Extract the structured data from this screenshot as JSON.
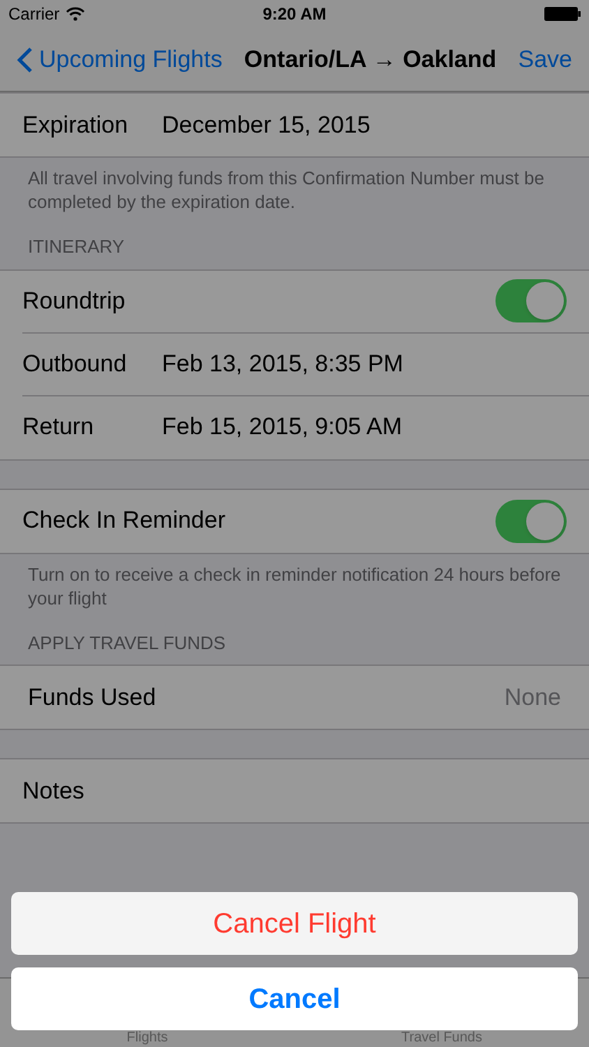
{
  "status_bar": {
    "carrier": "Carrier",
    "time": "9:20 AM"
  },
  "nav_bar": {
    "back": "Upcoming Flights",
    "title": "Ontario/LA → Oakland",
    "action": "Save"
  },
  "sections": [
    {
      "rows": [
        {
          "kind": "value",
          "label": "Expiration",
          "value": "December 15, 2015"
        }
      ],
      "footer": "All travel involving funds from this Confirmation Number must be completed by the expiration date."
    },
    {
      "header": "ITINERARY",
      "rows": [
        {
          "kind": "switch",
          "label": "Roundtrip",
          "on": true
        },
        {
          "kind": "value",
          "label": "Outbound",
          "value": "Feb 13, 2015, 8:35 PM"
        },
        {
          "kind": "value",
          "label": "Return",
          "value": "Feb 15, 2015, 9:05 AM"
        }
      ]
    },
    {
      "rows": [
        {
          "kind": "switch",
          "label": "Check In Reminder",
          "on": true
        }
      ],
      "footer": "Turn on to receive a check in reminder notification 24 hours before your flight"
    },
    {
      "header": "APPLY TRAVEL FUNDS",
      "rows": [
        {
          "kind": "detail",
          "label": "Funds Used",
          "value": "None"
        }
      ]
    },
    {
      "rows": [
        {
          "kind": "plain",
          "label": "Notes"
        }
      ]
    }
  ],
  "tab_bar": [
    "Flights",
    "Travel Funds"
  ],
  "action_sheet": {
    "actions": [
      {
        "kind": "destructive",
        "label": "Cancel Flight"
      }
    ],
    "cancel": "Cancel"
  }
}
